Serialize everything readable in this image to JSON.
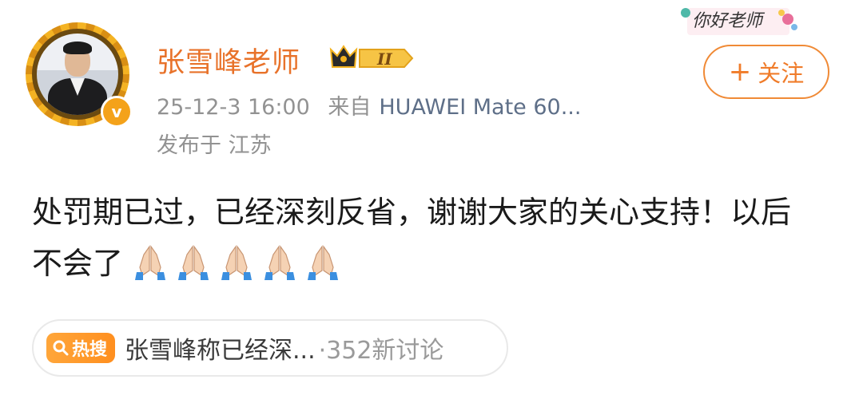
{
  "user": {
    "name": "张雪峰老师",
    "vip_level": "II",
    "verified_mark": "v"
  },
  "meta": {
    "timestamp": "25-12-3 16:00",
    "source_prefix": "来自",
    "device": "HUAWEI Mate 60...",
    "location": "发布于 江苏"
  },
  "follow": {
    "plus": "+",
    "label": "关注"
  },
  "sticker": {
    "text": "你好老师"
  },
  "post": {
    "text": "处罚期已过，已经深刻反省，谢谢大家的关心支持！以后不会了",
    "emoji_icon": "folded-hands",
    "emoji_count": 5
  },
  "hot_search": {
    "tag": "热搜",
    "title": "张雪峰称已经深...",
    "count": "·352新讨论"
  },
  "colors": {
    "username": "#e8722a",
    "accent": "#f08a36",
    "meta_gray": "#929292",
    "device_blue": "#5e6f88",
    "hot_tag": "#ff8f1f"
  }
}
